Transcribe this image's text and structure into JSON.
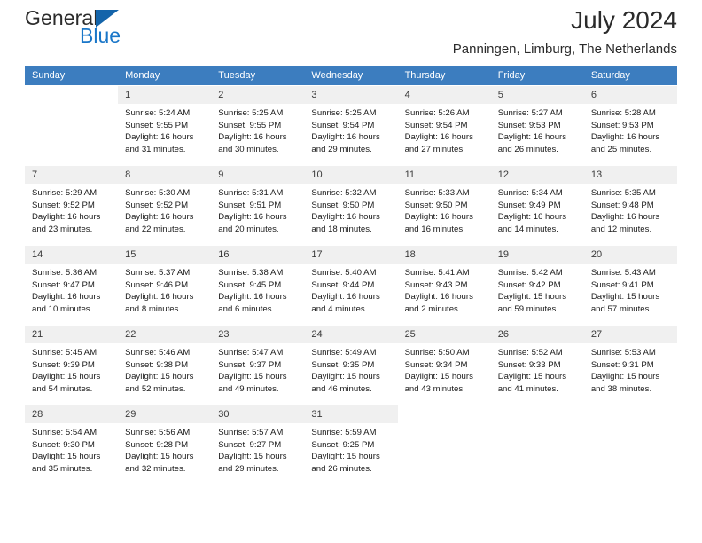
{
  "brand": {
    "line1": "General",
    "line2": "Blue",
    "mark": "triangle-logo",
    "accent_color": "#1976c8"
  },
  "header": {
    "title": "July 2024",
    "subtitle": "Panningen, Limburg, The Netherlands"
  },
  "theme": {
    "header_bg": "#3c7dbf",
    "header_text": "#ffffff",
    "daynum_bg": "#f0f0f0",
    "body_text": "#1a1a1a"
  },
  "weekdays": [
    "Sunday",
    "Monday",
    "Tuesday",
    "Wednesday",
    "Thursday",
    "Friday",
    "Saturday"
  ],
  "weeks": [
    [
      {
        "day": "",
        "sunrise": "",
        "sunset": "",
        "daylight1": "",
        "daylight2": ""
      },
      {
        "day": "1",
        "sunrise": "Sunrise: 5:24 AM",
        "sunset": "Sunset: 9:55 PM",
        "daylight1": "Daylight: 16 hours",
        "daylight2": "and 31 minutes."
      },
      {
        "day": "2",
        "sunrise": "Sunrise: 5:25 AM",
        "sunset": "Sunset: 9:55 PM",
        "daylight1": "Daylight: 16 hours",
        "daylight2": "and 30 minutes."
      },
      {
        "day": "3",
        "sunrise": "Sunrise: 5:25 AM",
        "sunset": "Sunset: 9:54 PM",
        "daylight1": "Daylight: 16 hours",
        "daylight2": "and 29 minutes."
      },
      {
        "day": "4",
        "sunrise": "Sunrise: 5:26 AM",
        "sunset": "Sunset: 9:54 PM",
        "daylight1": "Daylight: 16 hours",
        "daylight2": "and 27 minutes."
      },
      {
        "day": "5",
        "sunrise": "Sunrise: 5:27 AM",
        "sunset": "Sunset: 9:53 PM",
        "daylight1": "Daylight: 16 hours",
        "daylight2": "and 26 minutes."
      },
      {
        "day": "6",
        "sunrise": "Sunrise: 5:28 AM",
        "sunset": "Sunset: 9:53 PM",
        "daylight1": "Daylight: 16 hours",
        "daylight2": "and 25 minutes."
      }
    ],
    [
      {
        "day": "7",
        "sunrise": "Sunrise: 5:29 AM",
        "sunset": "Sunset: 9:52 PM",
        "daylight1": "Daylight: 16 hours",
        "daylight2": "and 23 minutes."
      },
      {
        "day": "8",
        "sunrise": "Sunrise: 5:30 AM",
        "sunset": "Sunset: 9:52 PM",
        "daylight1": "Daylight: 16 hours",
        "daylight2": "and 22 minutes."
      },
      {
        "day": "9",
        "sunrise": "Sunrise: 5:31 AM",
        "sunset": "Sunset: 9:51 PM",
        "daylight1": "Daylight: 16 hours",
        "daylight2": "and 20 minutes."
      },
      {
        "day": "10",
        "sunrise": "Sunrise: 5:32 AM",
        "sunset": "Sunset: 9:50 PM",
        "daylight1": "Daylight: 16 hours",
        "daylight2": "and 18 minutes."
      },
      {
        "day": "11",
        "sunrise": "Sunrise: 5:33 AM",
        "sunset": "Sunset: 9:50 PM",
        "daylight1": "Daylight: 16 hours",
        "daylight2": "and 16 minutes."
      },
      {
        "day": "12",
        "sunrise": "Sunrise: 5:34 AM",
        "sunset": "Sunset: 9:49 PM",
        "daylight1": "Daylight: 16 hours",
        "daylight2": "and 14 minutes."
      },
      {
        "day": "13",
        "sunrise": "Sunrise: 5:35 AM",
        "sunset": "Sunset: 9:48 PM",
        "daylight1": "Daylight: 16 hours",
        "daylight2": "and 12 minutes."
      }
    ],
    [
      {
        "day": "14",
        "sunrise": "Sunrise: 5:36 AM",
        "sunset": "Sunset: 9:47 PM",
        "daylight1": "Daylight: 16 hours",
        "daylight2": "and 10 minutes."
      },
      {
        "day": "15",
        "sunrise": "Sunrise: 5:37 AM",
        "sunset": "Sunset: 9:46 PM",
        "daylight1": "Daylight: 16 hours",
        "daylight2": "and 8 minutes."
      },
      {
        "day": "16",
        "sunrise": "Sunrise: 5:38 AM",
        "sunset": "Sunset: 9:45 PM",
        "daylight1": "Daylight: 16 hours",
        "daylight2": "and 6 minutes."
      },
      {
        "day": "17",
        "sunrise": "Sunrise: 5:40 AM",
        "sunset": "Sunset: 9:44 PM",
        "daylight1": "Daylight: 16 hours",
        "daylight2": "and 4 minutes."
      },
      {
        "day": "18",
        "sunrise": "Sunrise: 5:41 AM",
        "sunset": "Sunset: 9:43 PM",
        "daylight1": "Daylight: 16 hours",
        "daylight2": "and 2 minutes."
      },
      {
        "day": "19",
        "sunrise": "Sunrise: 5:42 AM",
        "sunset": "Sunset: 9:42 PM",
        "daylight1": "Daylight: 15 hours",
        "daylight2": "and 59 minutes."
      },
      {
        "day": "20",
        "sunrise": "Sunrise: 5:43 AM",
        "sunset": "Sunset: 9:41 PM",
        "daylight1": "Daylight: 15 hours",
        "daylight2": "and 57 minutes."
      }
    ],
    [
      {
        "day": "21",
        "sunrise": "Sunrise: 5:45 AM",
        "sunset": "Sunset: 9:39 PM",
        "daylight1": "Daylight: 15 hours",
        "daylight2": "and 54 minutes."
      },
      {
        "day": "22",
        "sunrise": "Sunrise: 5:46 AM",
        "sunset": "Sunset: 9:38 PM",
        "daylight1": "Daylight: 15 hours",
        "daylight2": "and 52 minutes."
      },
      {
        "day": "23",
        "sunrise": "Sunrise: 5:47 AM",
        "sunset": "Sunset: 9:37 PM",
        "daylight1": "Daylight: 15 hours",
        "daylight2": "and 49 minutes."
      },
      {
        "day": "24",
        "sunrise": "Sunrise: 5:49 AM",
        "sunset": "Sunset: 9:35 PM",
        "daylight1": "Daylight: 15 hours",
        "daylight2": "and 46 minutes."
      },
      {
        "day": "25",
        "sunrise": "Sunrise: 5:50 AM",
        "sunset": "Sunset: 9:34 PM",
        "daylight1": "Daylight: 15 hours",
        "daylight2": "and 43 minutes."
      },
      {
        "day": "26",
        "sunrise": "Sunrise: 5:52 AM",
        "sunset": "Sunset: 9:33 PM",
        "daylight1": "Daylight: 15 hours",
        "daylight2": "and 41 minutes."
      },
      {
        "day": "27",
        "sunrise": "Sunrise: 5:53 AM",
        "sunset": "Sunset: 9:31 PM",
        "daylight1": "Daylight: 15 hours",
        "daylight2": "and 38 minutes."
      }
    ],
    [
      {
        "day": "28",
        "sunrise": "Sunrise: 5:54 AM",
        "sunset": "Sunset: 9:30 PM",
        "daylight1": "Daylight: 15 hours",
        "daylight2": "and 35 minutes."
      },
      {
        "day": "29",
        "sunrise": "Sunrise: 5:56 AM",
        "sunset": "Sunset: 9:28 PM",
        "daylight1": "Daylight: 15 hours",
        "daylight2": "and 32 minutes."
      },
      {
        "day": "30",
        "sunrise": "Sunrise: 5:57 AM",
        "sunset": "Sunset: 9:27 PM",
        "daylight1": "Daylight: 15 hours",
        "daylight2": "and 29 minutes."
      },
      {
        "day": "31",
        "sunrise": "Sunrise: 5:59 AM",
        "sunset": "Sunset: 9:25 PM",
        "daylight1": "Daylight: 15 hours",
        "daylight2": "and 26 minutes."
      },
      {
        "day": "",
        "sunrise": "",
        "sunset": "",
        "daylight1": "",
        "daylight2": ""
      },
      {
        "day": "",
        "sunrise": "",
        "sunset": "",
        "daylight1": "",
        "daylight2": ""
      },
      {
        "day": "",
        "sunrise": "",
        "sunset": "",
        "daylight1": "",
        "daylight2": ""
      }
    ]
  ]
}
